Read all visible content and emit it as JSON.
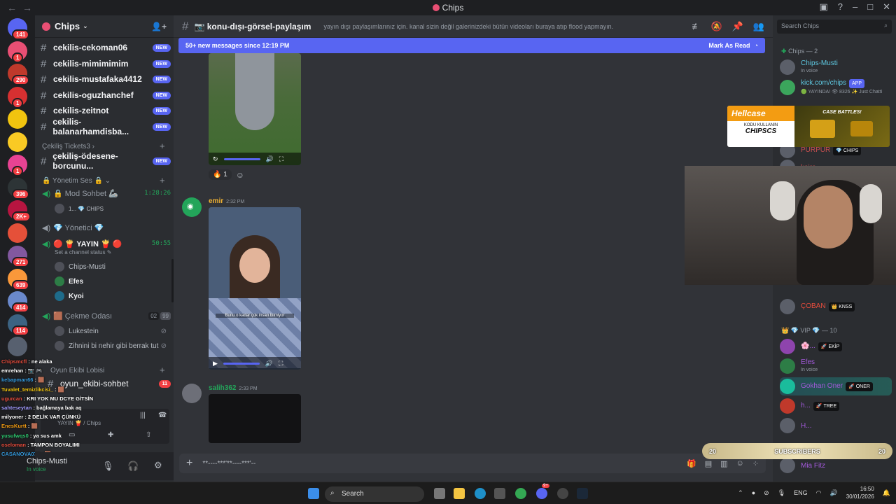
{
  "window": {
    "title": "Chips"
  },
  "guilds": [
    {
      "badge": "141",
      "color": "#5865f2"
    },
    {
      "badge": "1",
      "color": "#e94f74"
    },
    {
      "badge": "290",
      "color": "#c0392b"
    },
    {
      "badge": "1",
      "color": "#d63031"
    },
    {
      "badge": "",
      "color": "#f1c40f"
    },
    {
      "badge": "",
      "color": "#f9ca24"
    },
    {
      "badge": "1",
      "color": "#e84393"
    },
    {
      "badge": "396",
      "color": "#2d3436"
    },
    {
      "badge": "2K+",
      "color": "#b71540"
    },
    {
      "badge": "",
      "color": "#e55039"
    },
    {
      "badge": "271",
      "color": "#82589f"
    },
    {
      "badge": "639",
      "color": "#fa983a"
    },
    {
      "badge": "414",
      "color": "#6a89cc"
    },
    {
      "badge": "114",
      "color": "#3c6382"
    },
    {
      "badge": "",
      "color": "#57606f"
    }
  ],
  "server": {
    "name": "Chips"
  },
  "sidebar": {
    "text_channels": [
      {
        "name": "cekilis-cekoman06",
        "badge": "NEW"
      },
      {
        "name": "cekilis-mimimimim",
        "badge": "NEW"
      },
      {
        "name": "cekilis-mustafaka4412",
        "badge": "NEW"
      },
      {
        "name": "cekilis-oguzhanchef",
        "badge": "NEW"
      },
      {
        "name": "cekilis-zeitnot",
        "badge": "NEW"
      },
      {
        "name": "cekilis-balanarhamdisba...",
        "badge": "NEW"
      }
    ],
    "category_tickets": "Çekiliş Tickets3",
    "ticket_channel": {
      "name": "çekiliş-ödesene-borcunu...",
      "badge": "NEW"
    },
    "category_voice": "🔒 Yönetim Ses 🔒",
    "voice": [
      {
        "name": "🔒 Mod Sohbet 🦾",
        "time": "1:28:26"
      },
      {
        "name": "💎 Yönetici 💎",
        "time": ""
      },
      {
        "name": "🔴 🍟 YAYIN 🍟 🔴",
        "time": "50:55",
        "status": "Set a channel status ✎"
      },
      {
        "name": "🟫 Çekme Odası",
        "time": "",
        "count_a": "02",
        "count_b": "99"
      }
    ],
    "mod_user": "1... 💎 CHIPS",
    "yayin_users": [
      "Chips-Musti",
      "Efes",
      "Kyoi"
    ],
    "cekme_users": [
      "Lukestein",
      "Zihnini bi nehir gibi berrak tut"
    ],
    "lobby": "Oyun Ekibi Lobisi",
    "lobby_channel": {
      "name": "oyun_ekibi-sohbet",
      "badge": "11"
    },
    "voice_connected": "YAYIN 🍟 / Chips"
  },
  "chat_overlay": [
    {
      "user": "Chipsmcfl",
      "text": ": ne alaka",
      "color": "#e74c3c"
    },
    {
      "user": "emrehan",
      "text": ": 📷 🎮",
      "color": "#fff"
    },
    {
      "user": "kebapman66",
      "text": ": 🟫",
      "color": "#3498db"
    },
    {
      "user": "Tuvalet_temizlikcisi_",
      "text": ": 🟫",
      "color": "#f1c40f"
    },
    {
      "user": "ugurcan",
      "text": ": KRI YOK MU DCYE GİTSİN",
      "color": "#e74c3c"
    },
    {
      "user": "sahteseytan",
      "text": ": bağlamaya bak aq",
      "color": "#a29bfe"
    },
    {
      "user": "milyoner",
      "text": ": 2 DELİK VAR ÇÜNKÜ",
      "color": "#fff"
    },
    {
      "user": "EnesKurtt",
      "text": ": 🟫",
      "color": "#f39c12"
    },
    {
      "user": "yusufwqs0",
      "text": ": ya sus amk",
      "color": "#2ecc71"
    },
    {
      "user": "oseloman",
      "text": ": TAMPON BOYALIMI",
      "color": "#e74c3c"
    },
    {
      "user": "CASANOVA077",
      "text": ": 🟫",
      "color": "#3498db"
    }
  ],
  "user_panel": {
    "name": "Chips-Musti",
    "status": "In voice"
  },
  "channel_header": {
    "name": "📷 konu-dışı-görsel-paylaşım",
    "topic": "yayın dışı paylaşımlarınız için. kanal sizin değil galerinizdeki bütün videoları buraya atıp flood yapmayın."
  },
  "banner": {
    "text": "50+ new messages since 12:19 PM",
    "action": "Mark As Read"
  },
  "messages": [
    {
      "user": "emir",
      "time": "2:32 PM",
      "color": "#f0b232"
    },
    {
      "user": "salih362",
      "time": "2:33 PM",
      "color": "#23a55a"
    }
  ],
  "reaction": {
    "emoji": "🔥",
    "count": "1"
  },
  "video_caption": "Bunu o kadar çok insan bilmiyor",
  "composer": {
    "text": "**----***'**----***'--"
  },
  "members": {
    "search_placeholder": "Search Chips",
    "group_online": "Chips — 2",
    "top": [
      {
        "name": "Chips-Musti",
        "sub": "In voice",
        "tag": "",
        "color": "#5ec7e0"
      },
      {
        "name": "kick.com/chips",
        "sub": "🟢 YAYINDA! 👁 8326 ✨ Just Chatti",
        "tag": "APP",
        "color": "#5ec7e0"
      }
    ],
    "behind_ad": [
      {
        "name": "PURPUR",
        "tag": "💎 CHIPS"
      },
      {
        "name": "kaira"
      }
    ],
    "coban": {
      "name": "ÇOBAN",
      "tag": "👑 KNSS"
    },
    "group_vip": "👑 💎 VIP 💎 — 10",
    "vip": [
      {
        "name": "🌸...",
        "sub": "",
        "tag": "🚀 EKİP",
        "color": "#a259d9"
      },
      {
        "name": "Efes",
        "sub": "In voice",
        "tag": "",
        "color": "#a259d9"
      },
      {
        "name": "Gokhan Oner",
        "sub": "",
        "tag": "🚀 ONER",
        "color": "#a259d9"
      },
      {
        "name": "h...",
        "sub": "",
        "tag": "🚀 TREE",
        "color": "#a259d9"
      },
      {
        "name": "H...",
        "sub": "",
        "tag": "",
        "color": "#a259d9"
      },
      {
        "name": "Mia Fitz",
        "sub": "",
        "tag": "",
        "color": "#a259d9"
      }
    ]
  },
  "ad": {
    "brand": "Hellcase",
    "line1": "KODU KULLANIN",
    "code": "CHIPSCS",
    "promo": "CASE BATTLES!"
  },
  "subscribers": {
    "label": "SUBSCRIBERS",
    "left": "20",
    "right": "20"
  },
  "taskbar": {
    "search": "Search",
    "clock_time": "16:50",
    "clock_date": "30/01/2026",
    "lang": "ENG",
    "discord_badge": "9+"
  }
}
